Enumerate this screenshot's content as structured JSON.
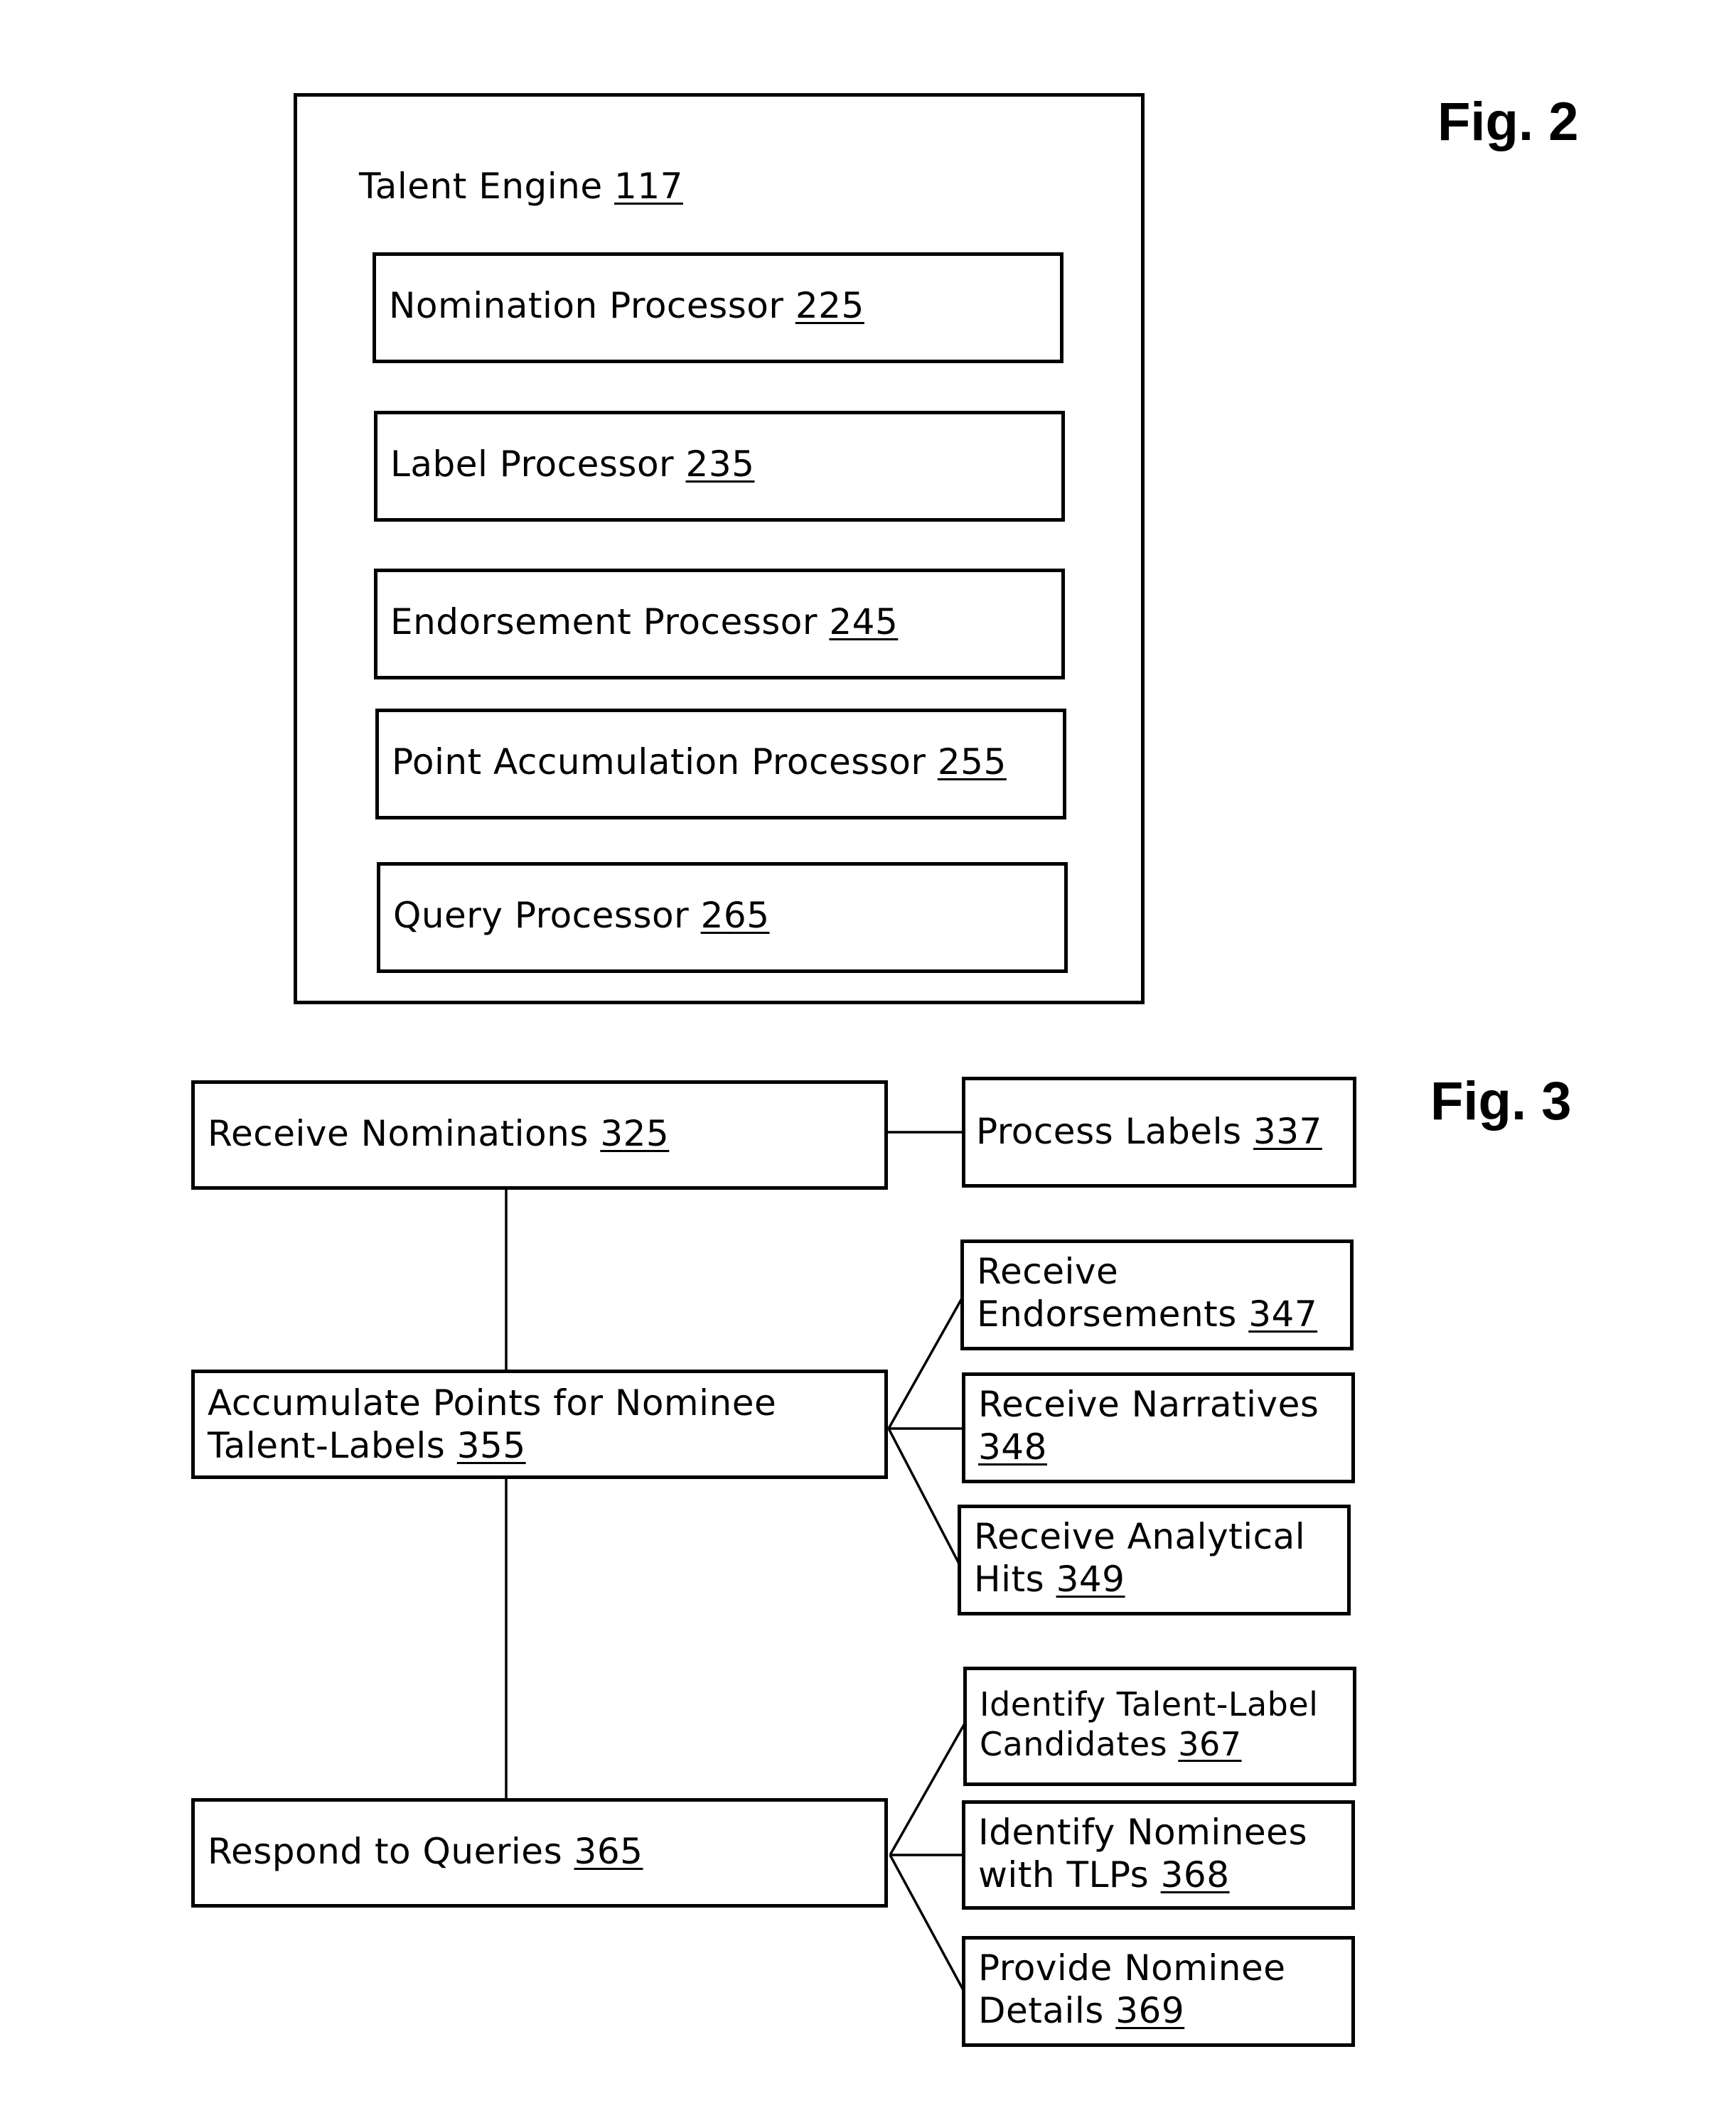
{
  "figures": {
    "fig2": {
      "label": "Fig. 2",
      "container": {
        "title": "Talent Engine",
        "ref": "117"
      },
      "components": [
        {
          "title": "Nomination Processor",
          "ref": "225"
        },
        {
          "title": "Label Processor",
          "ref": "235"
        },
        {
          "title": "Endorsement Processor",
          "ref": "245"
        },
        {
          "title": "Point Accumulation Processor",
          "ref": "255"
        },
        {
          "title": "Query Processor",
          "ref": "265"
        }
      ]
    },
    "fig3": {
      "label": "Fig. 3",
      "steps": [
        {
          "line1": "Receive Nominations",
          "line2": "",
          "ref": "325",
          "substeps": [
            {
              "line1": "Process Labels",
              "line2": "",
              "ref": "337"
            }
          ]
        },
        {
          "line1": "Accumulate Points for Nominee",
          "line2": "Talent-Labels",
          "ref": "355",
          "substeps": [
            {
              "line1": "Receive",
              "line2": "Endorsements",
              "ref": "347"
            },
            {
              "line1": "Receive Narratives",
              "line2": "",
              "ref": "348"
            },
            {
              "line1": "Receive Analytical",
              "line2": "Hits",
              "ref": "349"
            }
          ]
        },
        {
          "line1": "Respond to Queries",
          "line2": "",
          "ref": "365",
          "substeps": [
            {
              "line1": "Identify Talent-Label",
              "line2": "Candidates",
              "ref": "367"
            },
            {
              "line1": "Identify Nominees",
              "line2": "with TLPs",
              "ref": "368"
            },
            {
              "line1": "Provide Nominee",
              "line2": "Details",
              "ref": "369"
            }
          ]
        }
      ]
    }
  }
}
